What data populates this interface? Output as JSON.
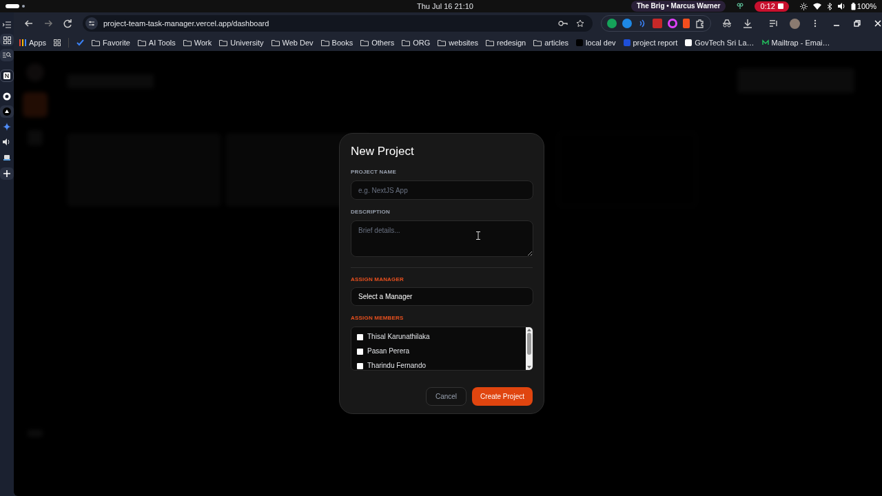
{
  "system_bar": {
    "datetime": "Thu Jul 16  21:10",
    "media": "The Brig • Marcus Warner",
    "recording": "0:12",
    "battery": "100%"
  },
  "browser": {
    "url": "project-team-task-manager.vercel.app/dashboard",
    "bookmarks": [
      {
        "kind": "apps",
        "label": "Apps"
      },
      {
        "kind": "folder",
        "label": "Favorite"
      },
      {
        "kind": "folder",
        "label": "AI Tools"
      },
      {
        "kind": "folder",
        "label": "Work"
      },
      {
        "kind": "folder",
        "label": "University"
      },
      {
        "kind": "folder",
        "label": "Web Dev"
      },
      {
        "kind": "folder",
        "label": "Books"
      },
      {
        "kind": "folder",
        "label": "Others"
      },
      {
        "kind": "folder",
        "label": "ORG"
      },
      {
        "kind": "folder",
        "label": "websites"
      },
      {
        "kind": "folder",
        "label": "redesign"
      },
      {
        "kind": "folder",
        "label": "articles"
      },
      {
        "kind": "site",
        "label": "local dev"
      },
      {
        "kind": "site",
        "label": "project report"
      },
      {
        "kind": "site",
        "label": "GovTech Sri La…"
      },
      {
        "kind": "site",
        "label": "Mailtrap - Emai…"
      }
    ]
  },
  "dialog": {
    "title": "New Project",
    "project_name": {
      "label": "PROJECT NAME",
      "placeholder": "e.g. NextJS App"
    },
    "description": {
      "label": "DESCRIPTION",
      "placeholder": "Brief details..."
    },
    "manager": {
      "label": "ASSIGN MANAGER",
      "value": "Select a Manager"
    },
    "members": {
      "label": "ASSIGN MEMBERS",
      "items": [
        {
          "name": "Thisal Karunathilaka",
          "checked": false
        },
        {
          "name": "Pasan Perera",
          "checked": false
        },
        {
          "name": "Tharindu Fernando",
          "checked": false
        }
      ]
    },
    "buttons": {
      "cancel": "Cancel",
      "create": "Create Project"
    }
  }
}
